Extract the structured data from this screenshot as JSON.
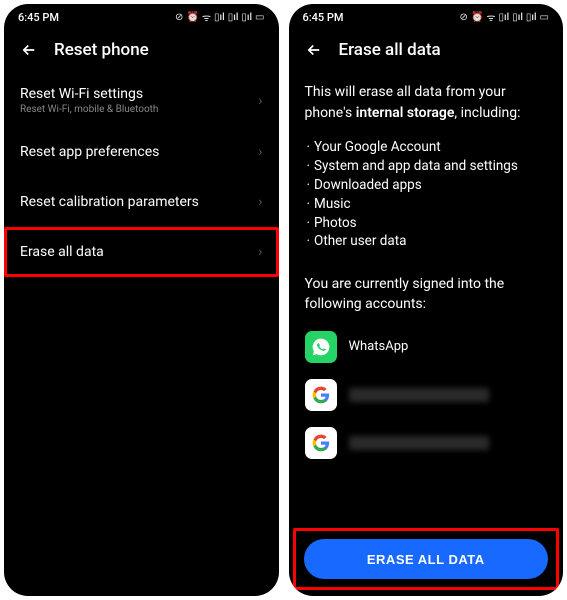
{
  "status": {
    "time": "6:45 PM",
    "icons_left": "⚈ ☁",
    "icons_right": "⊘ ⏰ ᯤ 📶 📶 📶 🔲"
  },
  "screen1": {
    "title": "Reset phone",
    "items": [
      {
        "label": "Reset Wi-Fi settings",
        "sub": "Reset Wi-Fi, mobile & Bluetooth"
      },
      {
        "label": "Reset app preferences",
        "sub": ""
      },
      {
        "label": "Reset calibration parameters",
        "sub": ""
      },
      {
        "label": "Erase all data",
        "sub": ""
      }
    ]
  },
  "screen2": {
    "title": "Erase all data",
    "intro_line1": "This will erase all data from your phone's",
    "intro_strong": "internal storage",
    "intro_suffix": ", including:",
    "bullets": [
      "Your Google Account",
      "System and app data and settings",
      "Downloaded apps",
      "Music",
      "Photos",
      "Other user data"
    ],
    "signed_in": "You are currently signed into the following accounts:",
    "accounts": [
      {
        "type": "whatsapp",
        "label": "WhatsApp"
      },
      {
        "type": "google",
        "label": ""
      },
      {
        "type": "google",
        "label": ""
      }
    ],
    "button": "ERASE ALL DATA"
  }
}
